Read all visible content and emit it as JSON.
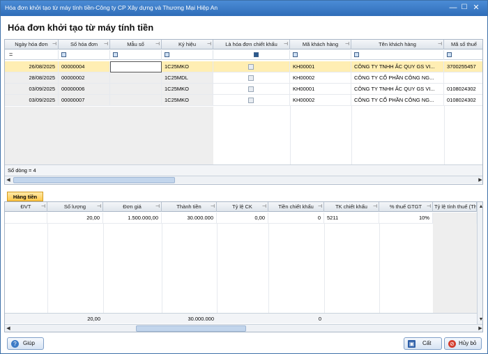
{
  "window": {
    "title": "Hóa đơn khởi tạo từ máy tính tiền-Công ty CP Xây dựng và Thương Mại Hiệp An",
    "minimize": "—",
    "maximize": "☐",
    "close": "✕"
  },
  "page_title": "Hóa đơn khởi tạo từ máy tính tiền",
  "top_grid": {
    "columns": [
      "Ngày hóa đơn",
      "Số hóa đơn",
      "Mẫu số",
      "Ký hiệu",
      "Là hóa đơn chiết khấu",
      "Mã khách hàng",
      "Tên khách hàng",
      "Mã số thuế"
    ],
    "filter_operator": "=",
    "rows": [
      {
        "date": "26/08/2025",
        "number": "00000004",
        "form": "",
        "symbol": "1C25MKO",
        "discount": false,
        "customer_code": "KH00001",
        "customer_name": "CÔNG TY TNHH ẮC QUY GS VI...",
        "tax_code": "3700255457"
      },
      {
        "date": "28/08/2025",
        "number": "00000002",
        "form": "",
        "symbol": "1C25MDL",
        "discount": false,
        "customer_code": "KH00002",
        "customer_name": "CÔNG TY CỔ PHẦN CÔNG NG...",
        "tax_code": ""
      },
      {
        "date": "03/09/2025",
        "number": "00000006",
        "form": "",
        "symbol": "1C25MKO",
        "discount": false,
        "customer_code": "KH00001",
        "customer_name": "CÔNG TY TNHH ẮC QUY GS VI...",
        "tax_code": "0108024302"
      },
      {
        "date": "03/09/2025",
        "number": "00000007",
        "form": "",
        "symbol": "1C25MKO",
        "discount": false,
        "customer_code": "KH00002",
        "customer_name": "CÔNG TY CỔ PHẦN CÔNG NG...",
        "tax_code": "0108024302"
      }
    ],
    "row_count": "Số dòng = 4"
  },
  "detail_tab": "Hàng tiền",
  "bottom_grid": {
    "columns": [
      "ĐVT",
      "Số lượng",
      "Đơn giá",
      "Thành tiền",
      "Tỷ lệ CK",
      "Tiền chiết khấu",
      "TK chiết khấu",
      "% thuế GTGT",
      "Tỷ lệ tính thuế (Thu"
    ],
    "rows": [
      {
        "unit": "",
        "qty": "20,00",
        "price": "1.500.000,00",
        "amount": "30.000.000",
        "ck_rate": "0,00",
        "ck_amount": "0",
        "ck_account": "5211",
        "vat": "10%",
        "tax_rate": ""
      }
    ],
    "totals": {
      "qty": "20,00",
      "amount": "30.000.000",
      "ck_amount": "0"
    }
  },
  "buttons": {
    "help": "Giúp",
    "save": "Cất",
    "cancel": "Hủy bỏ"
  },
  "icons": {
    "help": "help-icon",
    "save": "save-icon",
    "cancel": "cancel-icon"
  },
  "colors": {
    "titlebar": "#2f6db8",
    "selected_row": "#ffeeb3",
    "tab": "#ffc84a"
  }
}
